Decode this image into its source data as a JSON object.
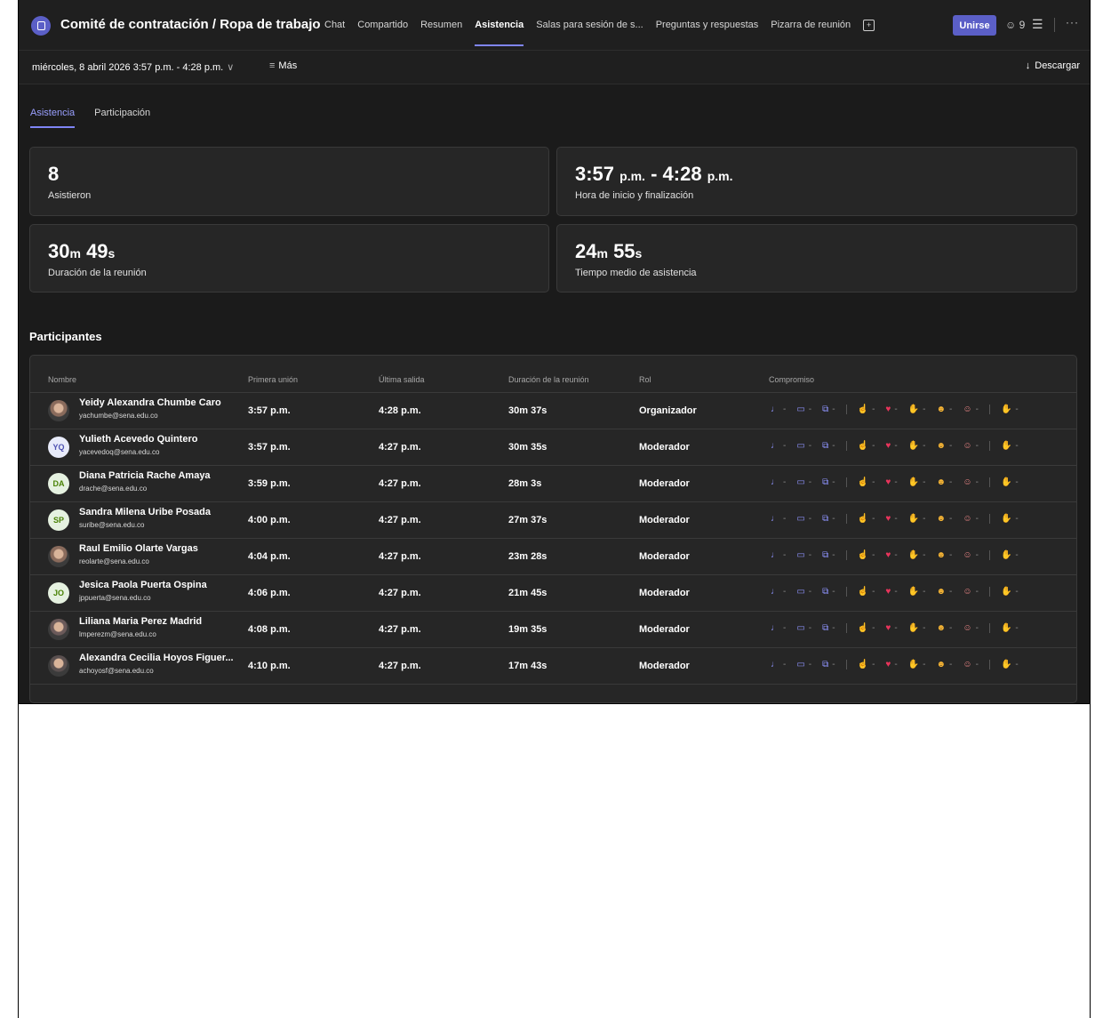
{
  "header": {
    "title": "Comité de contratación / Ropa de trabajo",
    "tabs": [
      {
        "label": "Chat"
      },
      {
        "label": "Compartido"
      },
      {
        "label": "Resumen"
      },
      {
        "label": "Asistencia"
      },
      {
        "label": "Salas para sesión de s..."
      },
      {
        "label": "Preguntas y respuestas"
      },
      {
        "label": "Pizarra de reunión"
      }
    ],
    "join_label": "Unirse",
    "people_count": "9"
  },
  "toolbar": {
    "date_range": "miércoles, 8 abril 2026 3:57 p.m. - 4:28 p.m.",
    "filter_label": "Más",
    "download_label": "Descargar"
  },
  "subtabs": [
    {
      "label": "Asistencia"
    },
    {
      "label": "Participación"
    }
  ],
  "stats": {
    "attended_value": "8",
    "attended_label": "Asistieron",
    "time_start": "3:57",
    "time_start_suffix": "p.m.",
    "time_sep": " - ",
    "time_end": "4:28",
    "time_end_suffix": "p.m.",
    "time_label": "Hora de inicio y finalización",
    "duration_min": "30",
    "duration_min_unit": "m",
    "duration_sec": "49",
    "duration_sec_unit": "s",
    "duration_label": "Duración de la reunión",
    "avg_min": "24",
    "avg_min_unit": "m",
    "avg_sec": "55",
    "avg_sec_unit": "s",
    "avg_label": "Tiempo medio de asistencia"
  },
  "participants": {
    "section_title": "Participantes",
    "columns": {
      "name": "Nombre",
      "first_join": "Primera unión",
      "last_leave": "Última salida",
      "duration": "Duración de la reunión",
      "role": "Rol",
      "engagement": "Compromiso"
    },
    "rows": [
      {
        "name": "Yeidy Alexandra Chumbe Caro",
        "email": "yachumbe@sena.edu.co",
        "initials": "",
        "first": "3:57 p.m.",
        "last": "4:28 p.m.",
        "duration": "30m 37s",
        "role": "Organizador"
      },
      {
        "name": "Yulieth Acevedo Quintero",
        "email": "yacevedoq@sena.edu.co",
        "initials": "YQ",
        "first": "3:57 p.m.",
        "last": "4:27 p.m.",
        "duration": "30m 35s",
        "role": "Moderador"
      },
      {
        "name": "Diana Patricia Rache Amaya",
        "email": "drache@sena.edu.co",
        "initials": "DA",
        "first": "3:59 p.m.",
        "last": "4:27 p.m.",
        "duration": "28m 3s",
        "role": "Moderador"
      },
      {
        "name": "Sandra Milena Uribe Posada",
        "email": "suribe@sena.edu.co",
        "initials": "SP",
        "first": "4:00 p.m.",
        "last": "4:27 p.m.",
        "duration": "27m 37s",
        "role": "Moderador"
      },
      {
        "name": "Raul Emilio Olarte Vargas",
        "email": "reolarte@sena.edu.co",
        "initials": "",
        "first": "4:04 p.m.",
        "last": "4:27 p.m.",
        "duration": "23m 28s",
        "role": "Moderador"
      },
      {
        "name": "Jesica Paola Puerta Ospina",
        "email": "jppuerta@sena.edu.co",
        "initials": "JO",
        "first": "4:06 p.m.",
        "last": "4:27 p.m.",
        "duration": "21m 45s",
        "role": "Moderador"
      },
      {
        "name": "Liliana Maria Perez Madrid",
        "email": "lmperezm@sena.edu.co",
        "initials": "",
        "first": "4:08 p.m.",
        "last": "4:27 p.m.",
        "duration": "19m 35s",
        "role": "Moderador"
      },
      {
        "name": "Alexandra Cecilia Hoyos Figuer...",
        "email": "achoyosf@sena.edu.co",
        "initials": "",
        "first": "4:10 p.m.",
        "last": "4:27 p.m.",
        "duration": "17m 43s",
        "role": "Moderador"
      }
    ],
    "engagement_value": "-"
  },
  "colors": {
    "accent": "#5b5fc7",
    "accent_light": "#7f85f5",
    "background": "#1f1f1f",
    "card": "#262626"
  },
  "icons": [
    "calendar-icon",
    "add-tab-icon",
    "people-icon",
    "list-icon",
    "more-icon",
    "filter-icon",
    "download-icon",
    "chevron-down-icon",
    "mic-icon",
    "camera-icon",
    "share-icon",
    "like-icon",
    "heart-icon",
    "clap-icon",
    "laugh-icon",
    "surprised-icon",
    "raise-hand-icon"
  ]
}
